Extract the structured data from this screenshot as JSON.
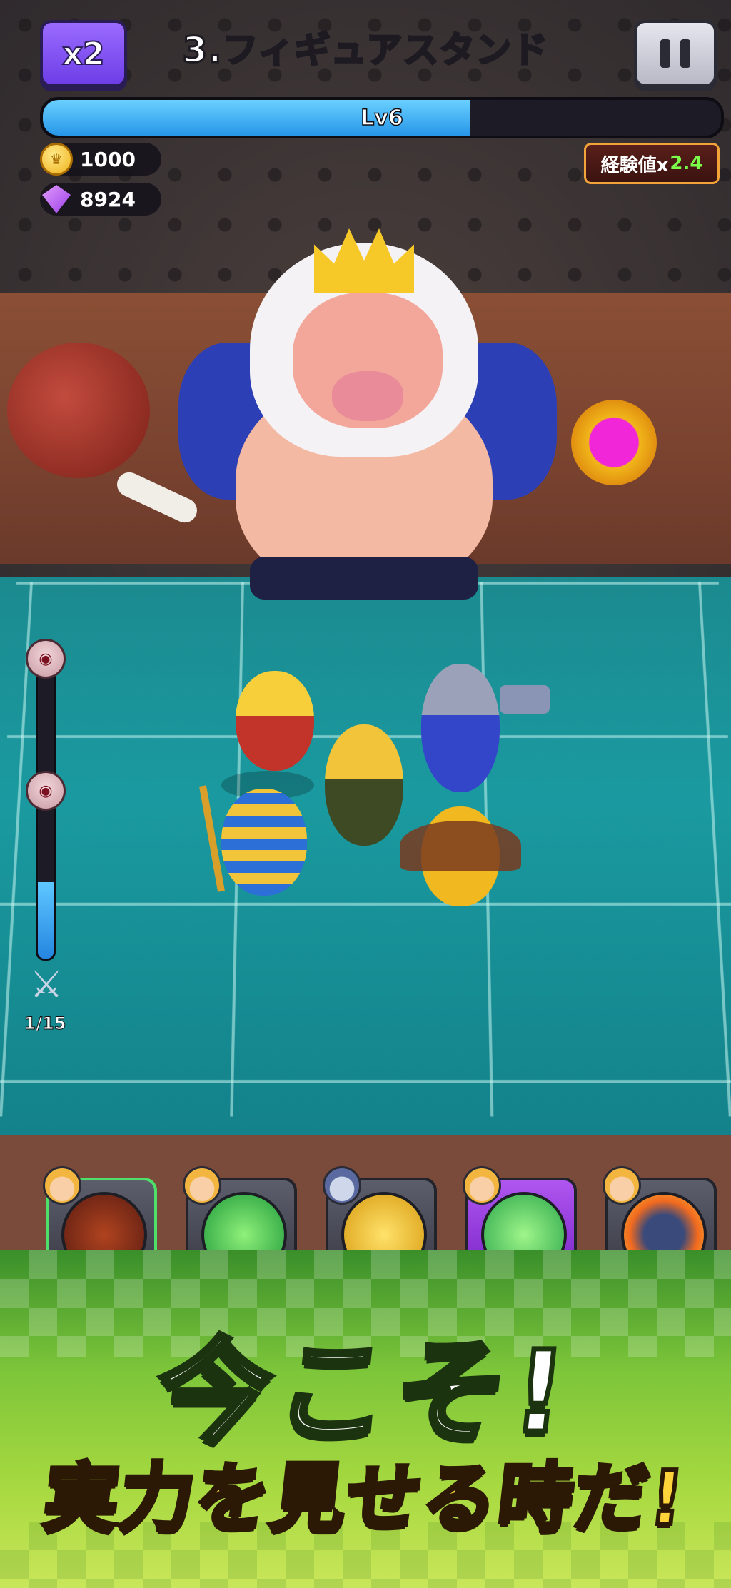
{
  "hud": {
    "speed_label": "x2",
    "stage_title": "3.フィギュアスタンド",
    "level_label": "Lv6",
    "xp_progress": 0.63,
    "coins": "1000",
    "gems": "8924",
    "exp_bonus_prefix": "経験値x",
    "exp_bonus_value": "2.4"
  },
  "wave": {
    "progress": 0.25,
    "count_label": "1/15"
  },
  "skills": [
    {
      "name": "meat-slash",
      "active": true
    },
    {
      "name": "spear-strike",
      "active": false
    },
    {
      "name": "lightning",
      "active": false
    },
    {
      "name": "sword-burst",
      "active": false,
      "highlight": "purple"
    },
    {
      "name": "bomb",
      "active": false
    }
  ],
  "promo": {
    "line1": "今こそ!",
    "line2": "実力を見せる時だ!"
  },
  "colors": {
    "accent_purple": "#6d3ee6",
    "xp_blue": "#2796e8",
    "floor_teal": "#1a9aa0",
    "promo_yellow": "#ffd43a",
    "exp_green": "#7cff4a"
  }
}
